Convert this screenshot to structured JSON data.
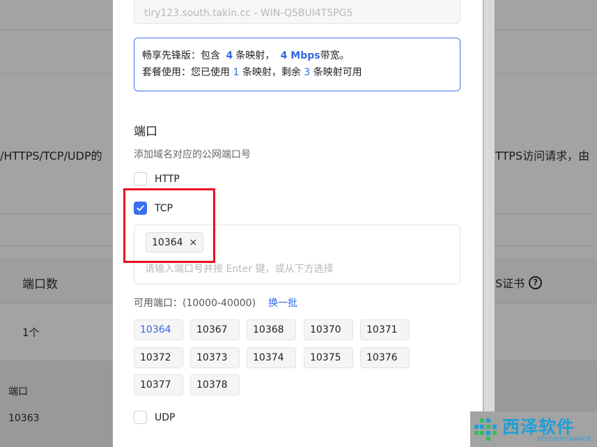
{
  "background": {
    "desc_left": "/HTTPS/TCP/UDP的",
    "desc_right": "TTPS访问请求，由",
    "col_port_count": "端口数",
    "col_cert": "S证书",
    "row_count": "1个",
    "detail_label": "端口",
    "detail_value": "10363"
  },
  "modal": {
    "host_value": "tlry123.south.takin.cc - WIN-Q5BUI4T5PG5",
    "info": {
      "l1_prefix": "畅享先锋版：包含",
      "l1_mappings": "4",
      "l1_mid": "条映射，",
      "l1_bandwidth": "4 Mbps",
      "l1_suffix": "带宽。",
      "l2_prefix": "套餐使用：您已使用",
      "l2_used": "1",
      "l2_mid": "条映射，剩余",
      "l2_left": "3",
      "l2_suffix": "条映射可用"
    },
    "section_title": "端口",
    "section_subtitle": "添加域名对应的公网端口号",
    "http_label": "HTTP",
    "tcp_label": "TCP",
    "udp_label": "UDP",
    "tcp_tag": "10364",
    "tag_close": "×",
    "port_placeholder": "请输入端口号并按 Enter 键，或从下方选择",
    "available_label": "可用端口：(10000-40000)",
    "refresh_label": "换一批",
    "available_ports": [
      "10364",
      "10367",
      "10368",
      "10370",
      "10371",
      "10372",
      "10373",
      "10374",
      "10375",
      "10376",
      "10377",
      "10378"
    ],
    "selected_port": "10364"
  },
  "watermark": {
    "cn": "西泽软件",
    "en": "SEEDSOFCHANGE"
  },
  "colors": {
    "accent": "#3c6ef0",
    "annotation": "#e8101e",
    "watermark": "#1e9fd8"
  }
}
